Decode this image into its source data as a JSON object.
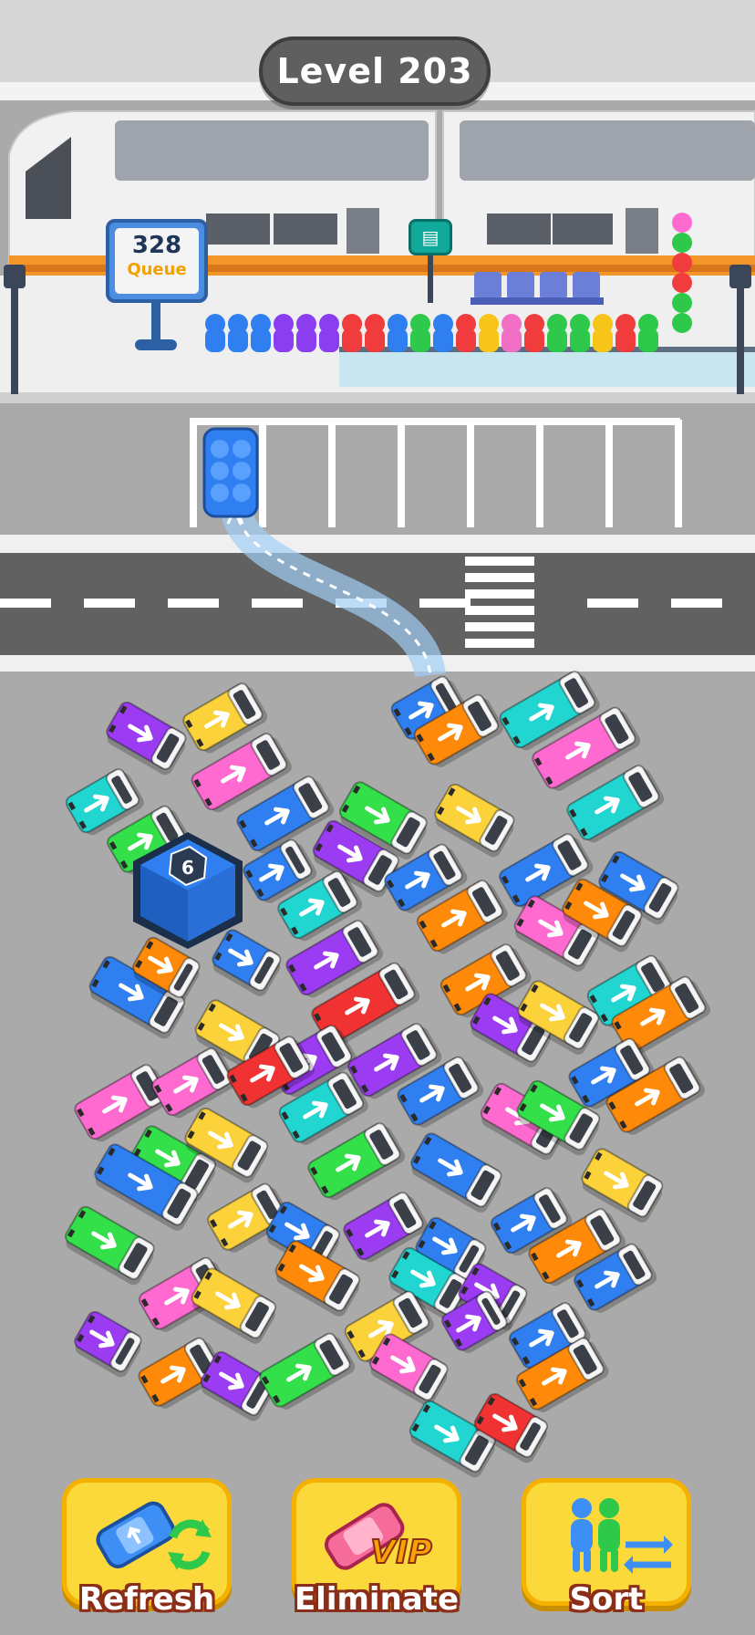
{
  "header": {
    "level_label": "Level 203"
  },
  "queue": {
    "count": "328",
    "label": "Queue"
  },
  "parking_lot": {
    "spots_total": 7,
    "occupied_spots": 1
  },
  "garage": {
    "count": "6"
  },
  "boosters": [
    {
      "label": "Refresh",
      "icon": "car-refresh-icon"
    },
    {
      "label": "Eliminate",
      "icon": "car-vip-icon"
    },
    {
      "label": "Sort",
      "icon": "people-swap-icon"
    }
  ],
  "vip_badge": "VIP",
  "passenger_colors": [
    "#2f7ff0",
    "#2f7ff0",
    "#2f7ff0",
    "#8b3df0",
    "#8b3df0",
    "#8b3df0",
    "#f03c3c",
    "#f03c3c",
    "#2f7ff0",
    "#2ec84a",
    "#2f7ff0",
    "#f03c3c",
    "#f7c51a",
    "#f06fc4",
    "#f03c3c",
    "#2ec84a",
    "#2ec84a",
    "#f7c51a",
    "#f03c3c",
    "#2ec84a"
  ],
  "colors": {
    "blue": "#2f7ff0",
    "orange": "#ff8a0a",
    "yellow": "#fbd23a",
    "pink": "#ff6ad0",
    "purple": "#9b3cf2",
    "green": "#33e04a",
    "cyan": "#21d6d0",
    "red": "#f03232"
  }
}
